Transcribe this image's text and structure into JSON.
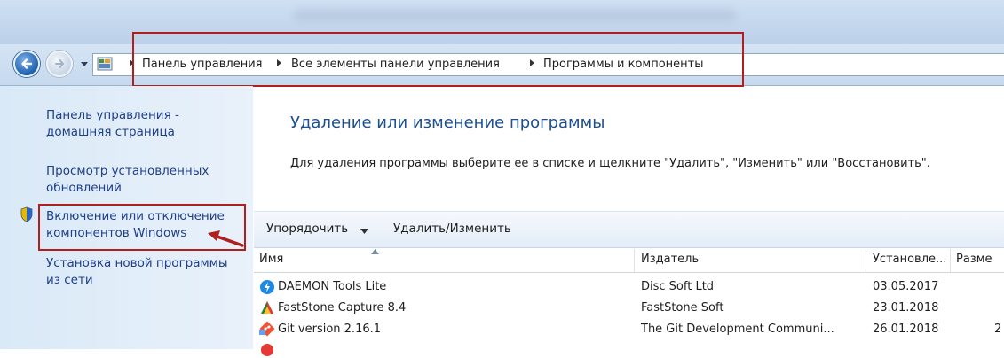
{
  "address": {
    "crumbs": [
      "Панель управления",
      "Все элементы панели управления",
      "Программы и компоненты"
    ]
  },
  "sidebar": {
    "items": [
      {
        "label_line1": "Панель управления -",
        "label_line2": "домашняя страница"
      },
      {
        "label_line1": "Просмотр установленных",
        "label_line2": "обновлений"
      },
      {
        "label_line1": "Включение или отключение",
        "label_line2": "компонентов Windows",
        "icon": "shield-icon"
      },
      {
        "label_line1": "Установка новой программы",
        "label_line2": "из сети"
      }
    ]
  },
  "main": {
    "heading": "Удаление или изменение программы",
    "description": "Для удаления программы выберите ее в списке и щелкните \"Удалить\", \"Изменить\" или \"Восстановить\"."
  },
  "toolbar": {
    "organize_label": "Упорядочить",
    "uninstall_label": "Удалить/Изменить"
  },
  "table": {
    "columns": [
      "Имя",
      "Издатель",
      "Установле...",
      "Разме"
    ],
    "rows": [
      {
        "name": "DAEMON Tools Lite",
        "publisher": "Disc Soft Ltd",
        "installed": "03.05.2017",
        "size": "",
        "icon": "daemon-tools-icon"
      },
      {
        "name": "FastStone Capture 8.4",
        "publisher": "FastStone Soft",
        "installed": "23.01.2018",
        "size": "",
        "icon": "faststone-icon"
      },
      {
        "name": "Git version 2.16.1",
        "publisher": "The Git Development Communi...",
        "installed": "26.01.2018",
        "size": "2",
        "icon": "git-icon"
      }
    ]
  },
  "colors": {
    "link": "#1e3f8a",
    "heading": "#1e4f8f",
    "annotation": "#b01e1e"
  }
}
